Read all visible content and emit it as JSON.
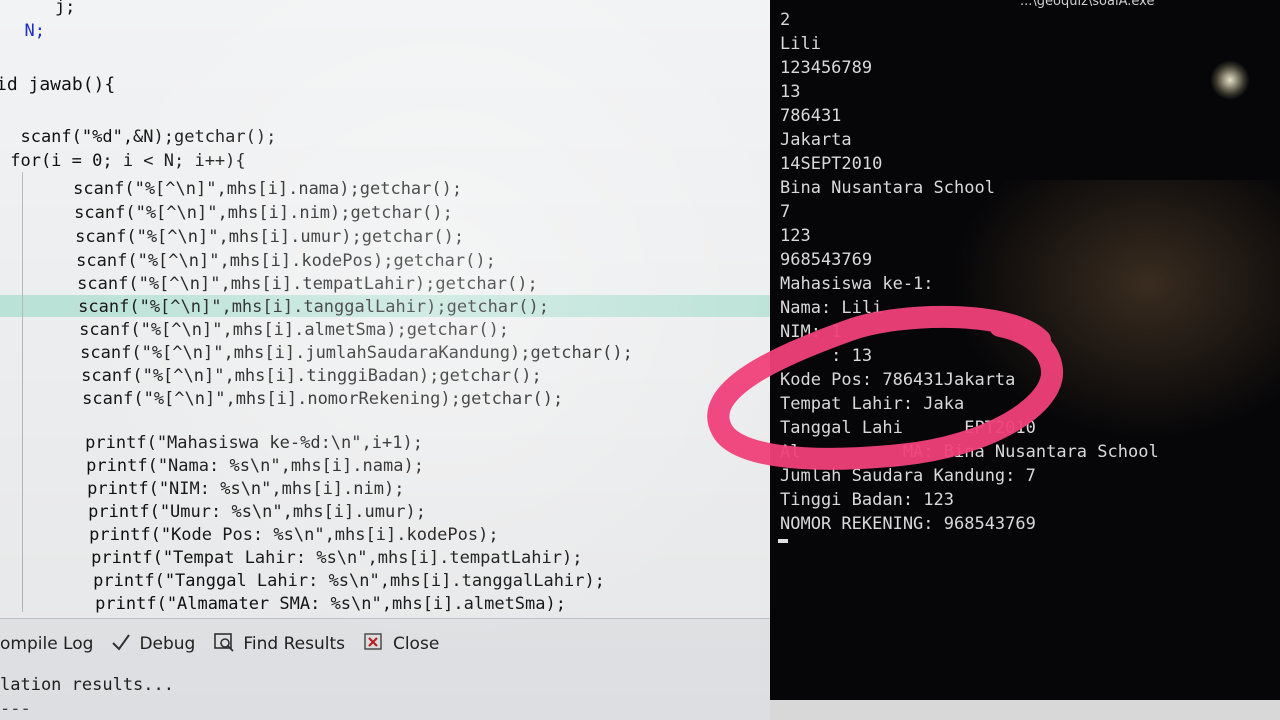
{
  "editor": {
    "code_lines": [
      {
        "id": "l0",
        "text": "    j;"
      },
      {
        "id": "l1",
        "text": "  N;"
      },
      {
        "id": "l2",
        "text": "id jawab(){"
      },
      {
        "id": "l3",
        "text": ""
      },
      {
        "id": "l4",
        "text": "  scanf(\"%d\",&N);getchar();"
      },
      {
        "id": "l5",
        "text": " for(i = 0; i < N; i++){"
      },
      {
        "id": "l6",
        "text": "     scanf(\"%[^\\n]\",mhs[i].nama);getchar();"
      },
      {
        "id": "l7",
        "text": "     scanf(\"%[^\\n]\",mhs[i].nim);getchar();"
      },
      {
        "id": "l8",
        "text": "     scanf(\"%[^\\n]\",mhs[i].umur);getchar();"
      },
      {
        "id": "l9",
        "text": "     scanf(\"%[^\\n]\",mhs[i].kodePos);getchar();"
      },
      {
        "id": "l10",
        "text": "     scanf(\"%[^\\n]\",mhs[i].tempatLahir);getchar();"
      },
      {
        "id": "l11",
        "text": "     scanf(\"%[^\\n]\",mhs[i].tanggalLahir);getchar();"
      },
      {
        "id": "l12",
        "text": "     scanf(\"%[^\\n]\",mhs[i].almetSma);getchar();"
      },
      {
        "id": "l13",
        "text": "     scanf(\"%[^\\n]\",mhs[i].jumlahSaudaraKandung);getchar();"
      },
      {
        "id": "l14",
        "text": "     scanf(\"%[^\\n]\",mhs[i].tinggiBadan);getchar();"
      },
      {
        "id": "l15",
        "text": "     scanf(\"%[^\\n]\",mhs[i].nomorRekening);getchar();"
      },
      {
        "id": "l16",
        "text": ""
      },
      {
        "id": "l17",
        "text": "     printf(\"Mahasiswa ke-%d:\\n\",i+1);"
      },
      {
        "id": "l18",
        "text": "     printf(\"Nama: %s\\n\",mhs[i].nama);"
      },
      {
        "id": "l19",
        "text": "     printf(\"NIM: %s\\n\",mhs[i].nim);"
      },
      {
        "id": "l20",
        "text": "     printf(\"Umur: %s\\n\",mhs[i].umur);"
      },
      {
        "id": "l21",
        "text": "     printf(\"Kode Pos: %s\\n\",mhs[i].kodePos);"
      },
      {
        "id": "l22",
        "text": "     printf(\"Tempat Lahir: %s\\n\",mhs[i].tempatLahir);"
      },
      {
        "id": "l23",
        "text": "     printf(\"Tanggal Lahir: %s\\n\",mhs[i].tanggalLahir);"
      },
      {
        "id": "l24",
        "text": "     printf(\"Almamater SMA: %s\\n\",mhs[i].almetSma);"
      }
    ]
  },
  "bottom_panel": {
    "tabs": [
      {
        "label": "ompile Log",
        "icon": "compile-log-icon"
      },
      {
        "label": "Debug",
        "icon": "checkmark-icon"
      },
      {
        "label": "Find Results",
        "icon": "find-results-icon"
      },
      {
        "label": "Close",
        "icon": "close-icon"
      }
    ],
    "results_text": "lation results...",
    "results_text2": "---"
  },
  "console": {
    "title": "...\\geoquiz\\soalA.exe",
    "lines": [
      "2",
      "Lili",
      "123456789",
      "13",
      "786431",
      "Jakarta",
      "14SEPT2010",
      "Bina Nusantara School",
      "7",
      "123",
      "968543769",
      "Mahasiswa ke-1:",
      "Nama: Lili",
      "NIM: 1",
      "     : 13",
      "Kode Pos: 786431Jakarta",
      "Tempat Lahir: Jaka",
      "Tanggal Lahi      EPT2010",
      "Al          MA: Bina Nusantara School",
      "Jumlah Saudara Kandung: 7",
      "Tinggi Badan: 123",
      "NOMOR REKENING: 968543769"
    ]
  },
  "colors": {
    "highlight_line": "#bfe7dc",
    "annotation_ring": "#f0407a",
    "string_color": "#1a37b8",
    "console_bg": "#060608"
  }
}
